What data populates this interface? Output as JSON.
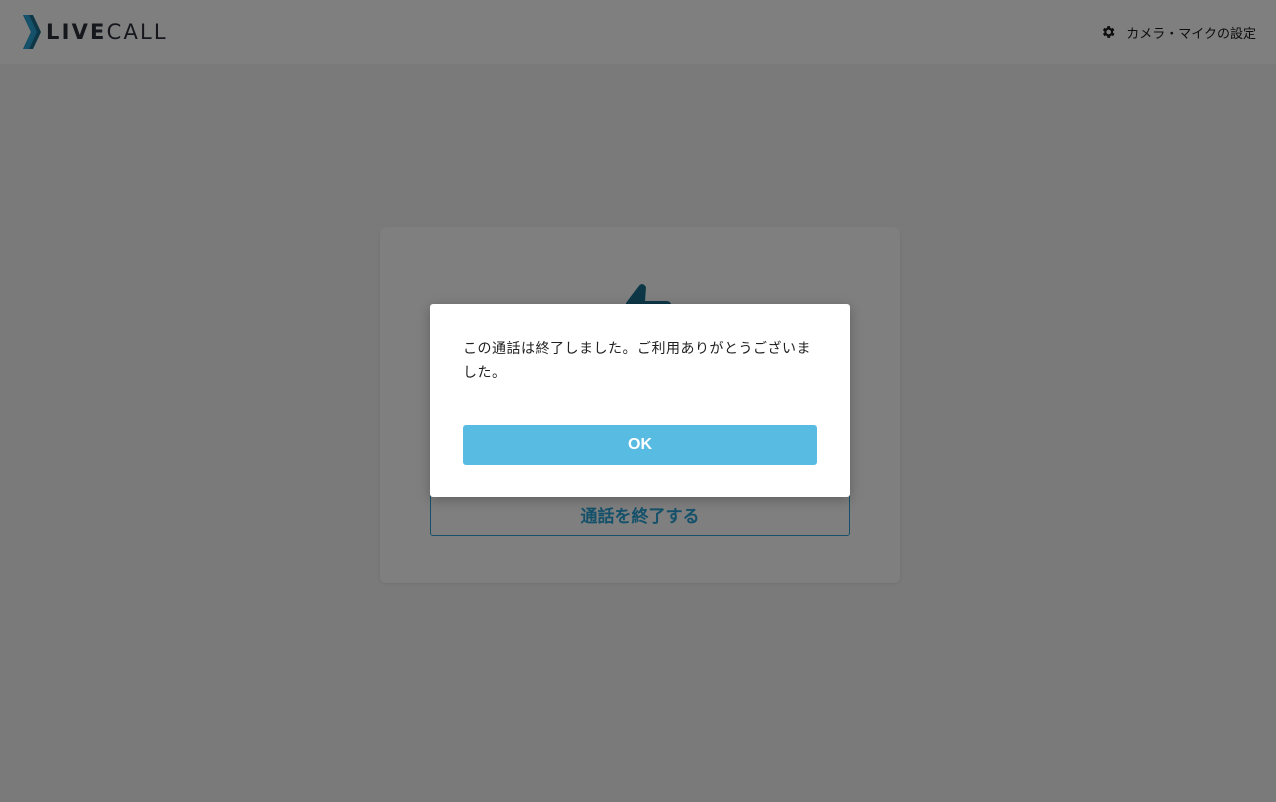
{
  "header": {
    "logo": {
      "live": "LIVE",
      "call": "CALL"
    },
    "settings_label": "カメラ・マイクの設定"
  },
  "card": {
    "end_call_label": "通話を終了する"
  },
  "modal": {
    "message": "この通話は終了しました。ご利用ありがとうございました。",
    "ok_label": "OK"
  },
  "colors": {
    "brand_teal": "#2aa3d4",
    "logo_dark_teal": "#1b6f8e",
    "ok_button": "#58bce2",
    "overlay": "rgba(0,0,0,0.5)"
  },
  "icons": {
    "logo_mark": "chevron-logo-icon",
    "settings": "gear-icon",
    "card_illustration": "thumbs-up-icon"
  }
}
